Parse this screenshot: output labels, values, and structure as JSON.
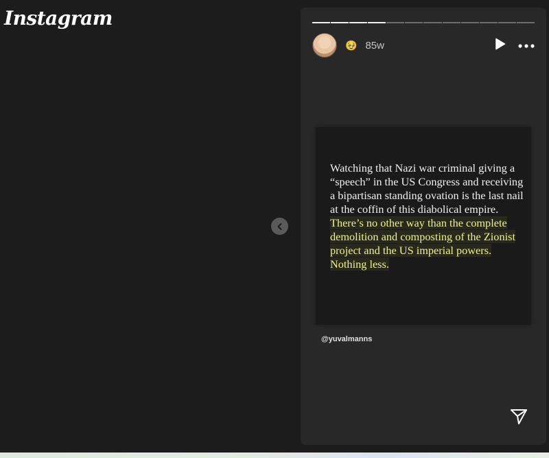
{
  "app": {
    "logo_text": "Instagram"
  },
  "navigation": {
    "prev_icon": "chevron-left-icon"
  },
  "story": {
    "progress": {
      "total_segments": 12,
      "current_segment": 4
    },
    "header": {
      "avatar_icon": "avatar",
      "emoji": "🥹",
      "timestamp": "85w",
      "play_icon": "play-icon",
      "more_icon": "more-horizontal-icon"
    },
    "card": {
      "quote_plain": "Watching that Nazi war criminal giving a “speech” in the US Congress and receiving a bipartisan standing ovation is the last nail at the coffin of this diabolical empire. ",
      "quote_highlight": "There’s no other way than the complete demolition and composting of the Zionist project and the US imperial powers. Nothing less.",
      "highlight_color": "#eef28a"
    },
    "handle": "@yuvalmanns",
    "send_icon": "send-icon"
  }
}
